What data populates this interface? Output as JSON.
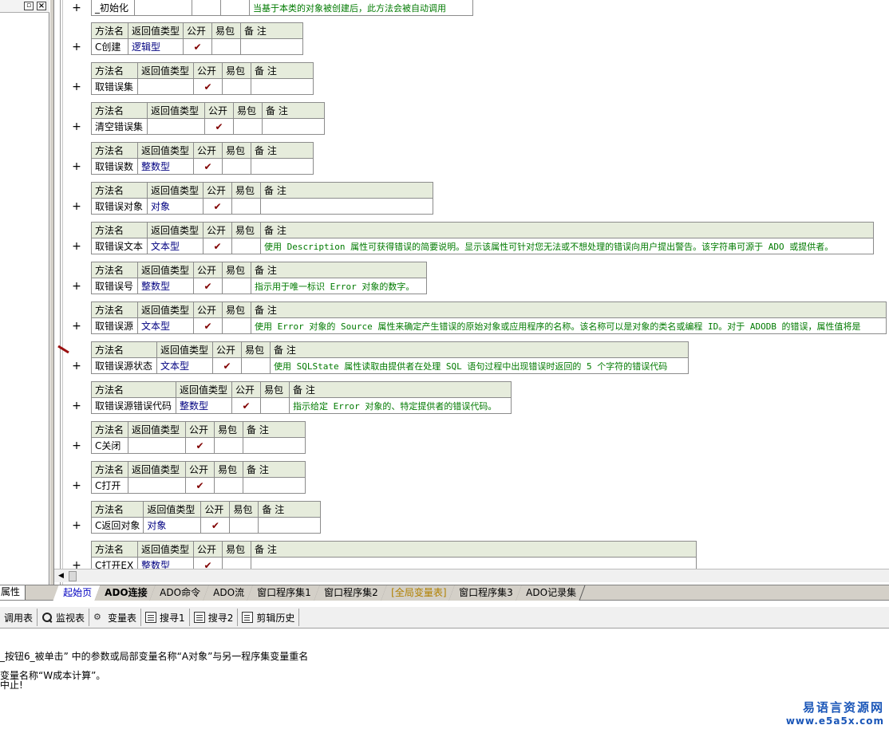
{
  "header": {
    "method_col": "方法名",
    "return_col": "返回值类型",
    "public_col": "公开",
    "easy_col": "易包",
    "note_col": "备 注",
    "check": "✔",
    "plus": "+"
  },
  "top_row": {
    "name": "_初始化",
    "note": "当基于本类的对象被创建后，此方法会被自动调用"
  },
  "methods": [
    {
      "name": "C创建",
      "type": "逻辑型",
      "public": true,
      "note": ""
    },
    {
      "name": "取错误集",
      "type": "",
      "public": true,
      "note": ""
    },
    {
      "name": "清空错误集",
      "type": "",
      "public": true,
      "note": ""
    },
    {
      "name": "取错误数",
      "type": "整数型",
      "public": true,
      "note": ""
    },
    {
      "name": "取错误对象",
      "type": "对象",
      "public": true,
      "note": ""
    },
    {
      "name": "取错误文本",
      "type": "文本型",
      "public": true,
      "note": "使用 Description 属性可获得错误的简要说明。显示该属性可针对您无法或不想处理的错误向用户提出警告。该字符串可源于 ADO 或提供者。"
    },
    {
      "name": "取错误号",
      "type": "整数型",
      "public": true,
      "note": "指示用于唯一标识 Error 对象的数字。"
    },
    {
      "name": "取错误源",
      "type": "文本型",
      "public": true,
      "note": "使用 Error 对象的 Source 属性来确定产生错误的原始对象或应用程序的名称。该名称可以是对象的类名或编程 ID。对于 ADODB 的错误，属性值将是"
    },
    {
      "name": "取错误源状态",
      "type": "文本型",
      "public": true,
      "note": "使用 SQLState 属性读取由提供者在处理 SQL 语句过程中出现错误时返回的 5 个字符的错误代码"
    },
    {
      "name": "取错误源错误代码",
      "type": "整数型",
      "public": true,
      "note": "指示给定 Error 对象的、特定提供者的错误代码。"
    },
    {
      "name": "C关闭",
      "type": "",
      "public": true,
      "note": ""
    },
    {
      "name": "C打开",
      "type": "",
      "public": true,
      "note": ""
    },
    {
      "name": "C返回对象",
      "type": "对象",
      "public": true,
      "note": ""
    },
    {
      "name": "C打开EX",
      "type": "整数型",
      "public": true,
      "note": ""
    }
  ],
  "left_tab": "属性",
  "tabs": [
    "起始页",
    "ADO连接",
    "ADO命令",
    "ADO流",
    "窗口程序集1",
    "窗口程序集2",
    "[全局变量表]",
    "窗口程序集3",
    "ADO记录集"
  ],
  "toolbar": [
    "调用表",
    "监视表",
    "变量表",
    "搜寻1",
    "搜寻2",
    "剪辑历史"
  ],
  "output": [
    "_按钮6_被单击” 中的参数或局部变量名称“A对象”与另一程序集变量重名",
    "变量名称“W成本计算”。",
    "中止!"
  ],
  "watermark": {
    "cn": "易语言资源网",
    "url": "www.e5a5x.com"
  }
}
